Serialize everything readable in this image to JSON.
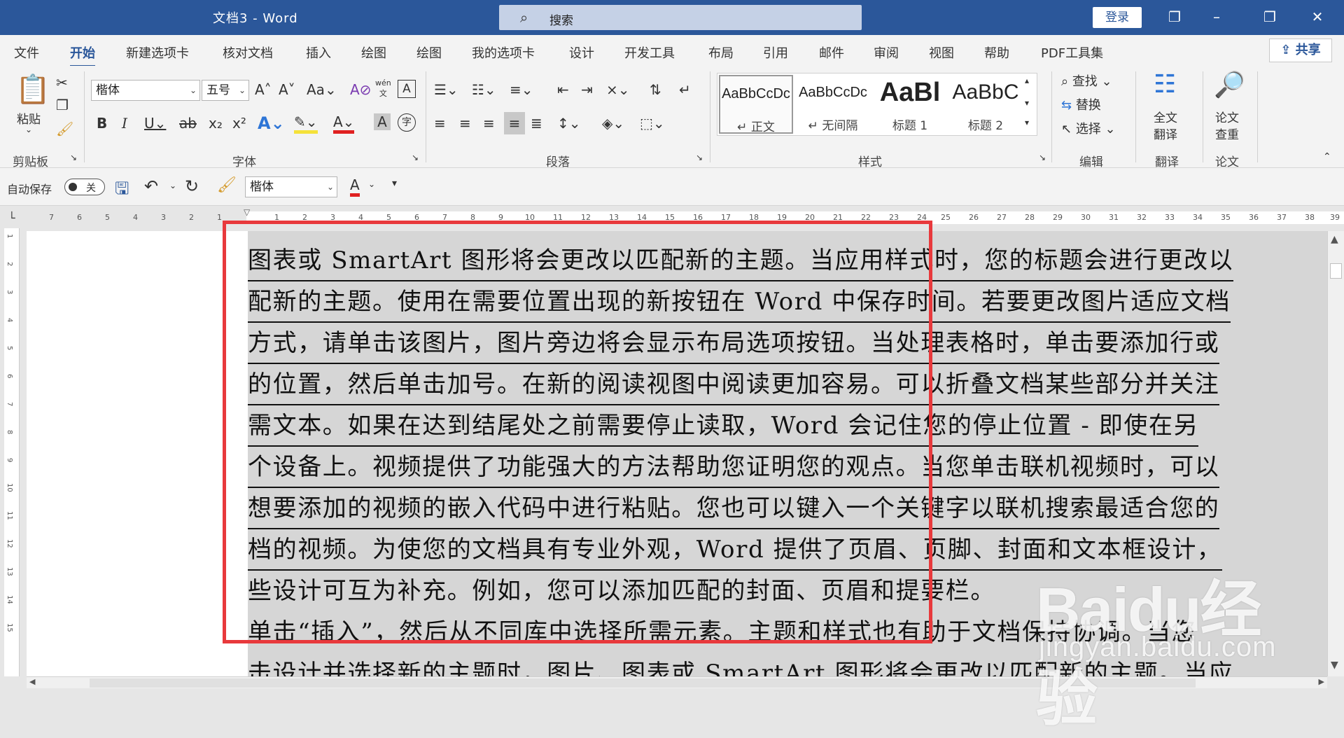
{
  "titlebar": {
    "title": "文档3  -  Word",
    "search_placeholder": "搜索",
    "login": "登录"
  },
  "tabs": [
    "文件",
    "开始",
    "新建选项卡",
    "核对文档",
    "插入",
    "绘图",
    "绘图",
    "我的选项卡",
    "设计",
    "开发工具",
    "布局",
    "引用",
    "邮件",
    "审阅",
    "视图",
    "帮助",
    "PDF工具集"
  ],
  "share": "共享",
  "ribbon": {
    "clipboard": {
      "paste": "粘贴",
      "label": "剪贴板"
    },
    "font": {
      "name": "楷体",
      "size": "五号",
      "wen": "wén",
      "label": "字体"
    },
    "paragraph": {
      "label": "段落"
    },
    "styles": {
      "items": [
        {
          "sample": "AaBbCcDc",
          "name": "↵ 正文"
        },
        {
          "sample": "AaBbCcDc",
          "name": "↵ 无间隔"
        },
        {
          "sample": "AaBl",
          "name": "标题 1"
        },
        {
          "sample": "AaBbC",
          "name": "标题 2"
        }
      ],
      "label": "样式"
    },
    "editing": {
      "find": "查找",
      "replace": "替换",
      "select": "选择",
      "label": "编辑"
    },
    "translate": {
      "full": "全文",
      "full2": "翻译",
      "label": "翻译"
    },
    "paper": {
      "check": "论文",
      "check2": "查重",
      "label": "论文"
    }
  },
  "qat": {
    "autosave": "自动保存",
    "toggle": "关",
    "font": "楷体"
  },
  "ruler": {
    "left_nums": [
      "7",
      "6",
      "5",
      "4",
      "3",
      "2",
      "1"
    ],
    "nums": [
      "1",
      "2",
      "3",
      "4",
      "5",
      "6",
      "7",
      "8",
      "9",
      "10",
      "11",
      "12",
      "13",
      "14",
      "15",
      "16",
      "17",
      "18",
      "19",
      "20",
      "21",
      "22",
      "23",
      "24",
      "25",
      "26",
      "27",
      "28",
      "29",
      "30",
      "31",
      "32",
      "33",
      "34",
      "35",
      "36",
      "37",
      "38",
      "39"
    ],
    "vnums": [
      "1",
      "2",
      "3",
      "4",
      "5",
      "6",
      "7",
      "8",
      "9",
      "10",
      "11",
      "12",
      "13",
      "14",
      "15"
    ]
  },
  "document": {
    "lines": [
      "图表或 SmartArt 图形将会更改以匹配新的主题。当应用样式时，您的标题会进行更改以",
      "配新的主题。使用在需要位置出现的新按钮在 Word 中保存时间。若要更改图片适应文档",
      "方式，请单击该图片，图片旁边将会显示布局选项按钮。当处理表格时，单击要添加行或",
      "的位置，然后单击加号。在新的阅读视图中阅读更加容易。可以折叠文档某些部分并关注",
      "需文本。如果在达到结尾处之前需要停止读取，Word 会记住您的停止位置 - 即使在另",
      "个设备上。视频提供了功能强大的方法帮助您证明您的观点。当您单击联机视频时，可以",
      "想要添加的视频的嵌入代码中进行粘贴。您也可以键入一个关键字以联机搜索最适合您的",
      "档的视频。为使您的文档具有专业外观，Word 提供了页眉、页脚、封面和文本框设计，",
      "些设计可互为补充。例如，您可以添加匹配的封面、页眉和提要栏。",
      "单击“插入”，然后从不同库中选择所需元素。主题和样式也有助于文档保持协调。当您",
      "击设计并选择新的主题时，图片、图表或 SmartArt 图形将会更改以匹配新的主题。当应"
    ]
  },
  "watermark": {
    "brand": "Baidu经验",
    "site": "jingyan.baidu.com"
  },
  "colors": {
    "accent": "#2b579a",
    "highlight_frame": "#e8393c"
  }
}
